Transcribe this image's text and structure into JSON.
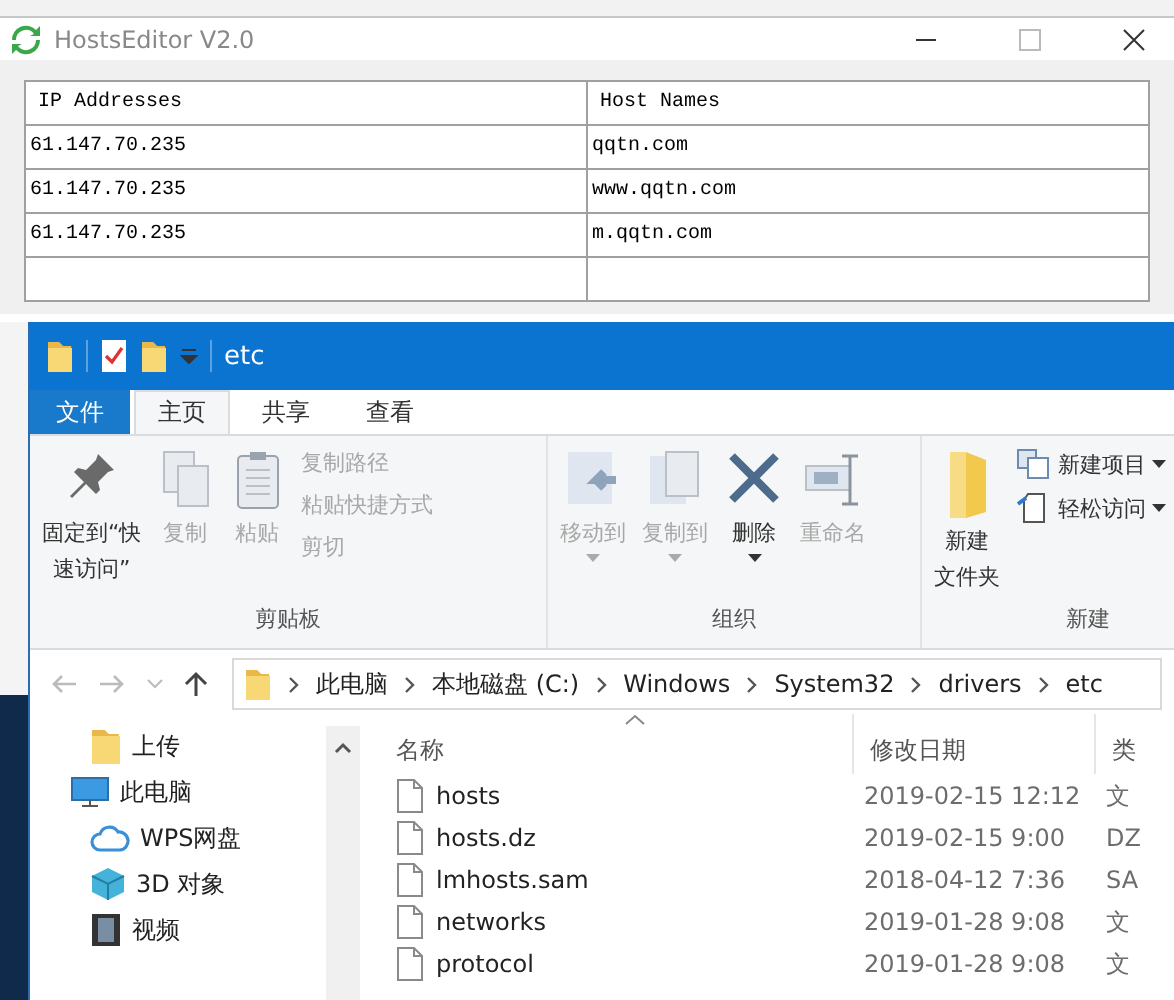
{
  "hosts_editor": {
    "title": "HostsEditor V2.0",
    "table": {
      "columns": [
        "IP Addresses",
        "Host Names"
      ],
      "rows": [
        [
          "61.147.70.235",
          "qqtn.com"
        ],
        [
          "61.147.70.235",
          "www.qqtn.com"
        ],
        [
          "61.147.70.235",
          "m.qqtn.com"
        ]
      ]
    }
  },
  "explorer": {
    "title": "etc",
    "tabs": [
      {
        "label": "文件",
        "kind": "file",
        "selected": false
      },
      {
        "label": "主页",
        "kind": "tab",
        "selected": true
      },
      {
        "label": "共享",
        "kind": "tab",
        "selected": false
      },
      {
        "label": "查看",
        "kind": "tab",
        "selected": false
      }
    ],
    "ribbon_groups": [
      {
        "label": "剪贴板",
        "items": [
          {
            "lines": [
              "固定到“快",
              "速访问”"
            ],
            "kind": "large",
            "disabled": false,
            "dropdown": false
          },
          {
            "lines": [
              "复制"
            ],
            "kind": "large",
            "disabled": true,
            "dropdown": false
          },
          {
            "lines": [
              "粘贴"
            ],
            "kind": "large",
            "disabled": true,
            "dropdown": false
          },
          {
            "lines": [
              "复制路径"
            ],
            "kind": "small",
            "disabled": true,
            "dropdown": false
          },
          {
            "lines": [
              "粘贴快捷方式"
            ],
            "kind": "small",
            "disabled": true,
            "dropdown": false
          },
          {
            "lines": [
              "剪切"
            ],
            "kind": "small",
            "disabled": true,
            "dropdown": false
          }
        ]
      },
      {
        "label": "组织",
        "items": [
          {
            "lines": [
              "移动到"
            ],
            "kind": "large",
            "disabled": true,
            "dropdown": true
          },
          {
            "lines": [
              "复制到"
            ],
            "kind": "large",
            "disabled": true,
            "dropdown": true
          },
          {
            "lines": [
              "删除"
            ],
            "kind": "large",
            "disabled": false,
            "dropdown": true
          },
          {
            "lines": [
              "重命名"
            ],
            "kind": "large",
            "disabled": true,
            "dropdown": false
          }
        ]
      },
      {
        "label": "新建",
        "items": [
          {
            "lines": [
              "新建",
              "文件夹"
            ],
            "kind": "large",
            "disabled": false,
            "dropdown": false
          },
          {
            "lines": [
              "新建项目"
            ],
            "kind": "small",
            "disabled": false,
            "dropdown": true
          },
          {
            "lines": [
              "轻松访问"
            ],
            "kind": "small",
            "disabled": false,
            "dropdown": true
          }
        ]
      }
    ],
    "address": [
      "此电脑",
      "本地磁盘 (C:)",
      "Windows",
      "System32",
      "drivers",
      "etc"
    ],
    "nav_items": [
      {
        "label": "上传",
        "kind": "folder"
      },
      {
        "label": "此电脑",
        "kind": "pc",
        "children": [
          {
            "label": "WPS网盘",
            "kind": "cloud"
          },
          {
            "label": "3D 对象",
            "kind": "cube"
          },
          {
            "label": "视频",
            "kind": "film"
          }
        ]
      }
    ],
    "file_columns": [
      "名称",
      "修改日期",
      "类"
    ],
    "files": [
      {
        "name": "hosts",
        "date": "2019-02-15 12:12",
        "type": "文"
      },
      {
        "name": "hosts.dz",
        "date": "2019-02-15 9:00",
        "type": "DZ"
      },
      {
        "name": "lmhosts.sam",
        "date": "2018-04-12 7:36",
        "type": "SA"
      },
      {
        "name": "networks",
        "date": "2019-01-28 9:08",
        "type": "文"
      },
      {
        "name": "protocol",
        "date": "2019-01-28 9:08",
        "type": "文"
      }
    ]
  }
}
